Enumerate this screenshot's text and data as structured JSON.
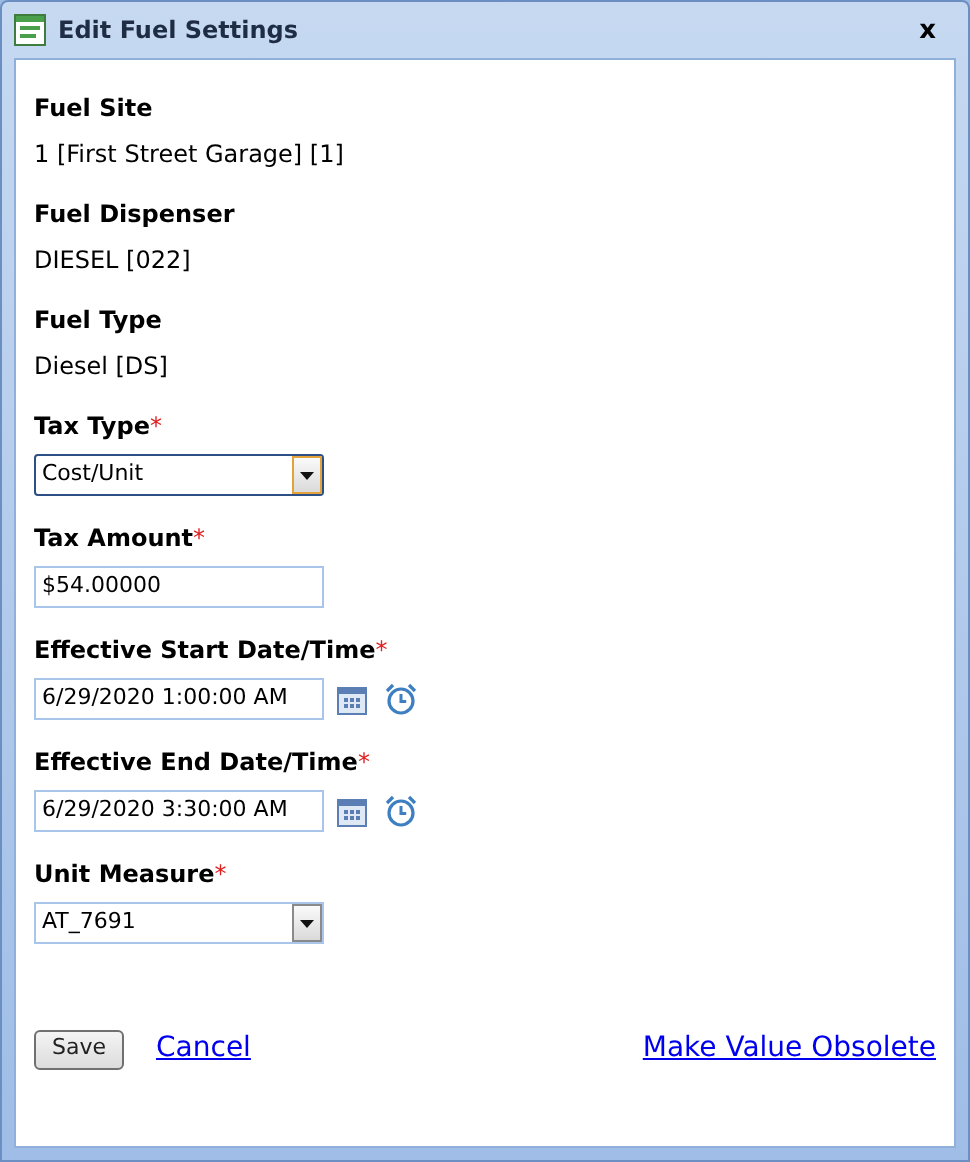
{
  "window": {
    "title": "Edit Fuel Settings",
    "close": "x"
  },
  "fields": [
    {
      "kind": "info",
      "label": "Fuel Site",
      "value": "1 [First Street Garage] [1]"
    },
    {
      "kind": "info",
      "label": "Fuel Dispenser",
      "value": "DIESEL [022]"
    },
    {
      "kind": "info",
      "label": "Fuel Type",
      "value": "Diesel [DS]"
    },
    {
      "kind": "select",
      "label": "Tax Type",
      "marker": "*",
      "value": "Cost/Unit",
      "focused": true
    },
    {
      "kind": "text",
      "label": "Tax Amount",
      "marker": "*",
      "value": "$54.00000"
    },
    {
      "kind": "datetime",
      "label": "Effective Start Date/Time",
      "marker": "*",
      "value": "6/29/2020 1:00:00 AM"
    },
    {
      "kind": "datetime",
      "label": "Effective End Date/Time",
      "marker": "*",
      "value": "6/29/2020 3:30:00 AM"
    },
    {
      "kind": "select",
      "label": "Unit Measure",
      "marker": "*",
      "value": "AT_7691",
      "focused": false
    }
  ],
  "actions": {
    "save": "Save",
    "cancel": "Cancel",
    "obsolete": "Make Value Obsolete"
  }
}
